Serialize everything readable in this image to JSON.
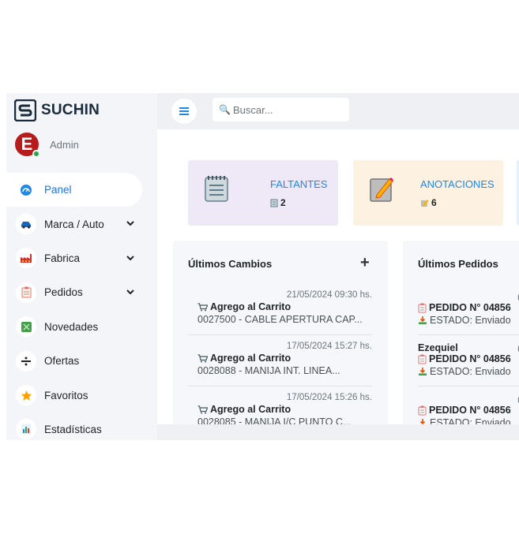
{
  "brand": {
    "name": "SUCHIN"
  },
  "user": {
    "initial": "E",
    "role": "Admin"
  },
  "sidebar": {
    "items": [
      {
        "label": "Panel",
        "icon": "dashboard-icon",
        "active": true
      },
      {
        "label": "Marca / Auto",
        "icon": "car-icon",
        "expandable": true
      },
      {
        "label": "Fabrica",
        "icon": "factory-icon",
        "expandable": true
      },
      {
        "label": "Pedidos",
        "icon": "clipboard-icon",
        "expandable": true
      },
      {
        "label": "Novedades",
        "icon": "news-icon"
      },
      {
        "label": "Ofertas",
        "icon": "divide-icon"
      },
      {
        "label": "Favoritos",
        "icon": "star-icon"
      },
      {
        "label": "Estadísticas",
        "icon": "chart-icon"
      }
    ]
  },
  "topbar": {
    "search_placeholder": "Buscar..."
  },
  "stats": [
    {
      "title": "FALTANTES",
      "count": "2",
      "icon": "notepad-icon"
    },
    {
      "title": "ANOTACIONES",
      "count": "6",
      "icon": "pencil-note-icon"
    }
  ],
  "changes": {
    "title": "Últimos Cambios",
    "entries": [
      {
        "time": "21/05/2024 09:30 hs.",
        "action": "Agrego al Carrito",
        "detail": "0027500 - CABLE APERTURA CAP..."
      },
      {
        "time": "17/05/2024 15:27 hs.",
        "action": "Agrego al Carrito",
        "detail": "0028088 - MANIJA INT. LINEA..."
      },
      {
        "time": "17/05/2024 15:26 hs.",
        "action": "Agrego al Carrito",
        "detail": "0028085 - MANIJA I/C PUNTO C..."
      }
    ]
  },
  "orders": {
    "title": "Últimos Pedidos",
    "entries": [
      {
        "name": "",
        "frag": "(",
        "number": "PEDIDO N° 04856",
        "status": "ESTADO: Enviado"
      },
      {
        "name": "Ezequiel",
        "frag": "(",
        "number": "PEDIDO N° 04856",
        "status": "ESTADO: Enviado"
      },
      {
        "name": "",
        "frag": "(",
        "number": "PEDIDO N° 04856",
        "status": "ESTADO: Enviado"
      }
    ]
  },
  "colors": {
    "accent": "#1e88e5",
    "avatar": "#b71c1c",
    "status_online": "#28a745"
  }
}
